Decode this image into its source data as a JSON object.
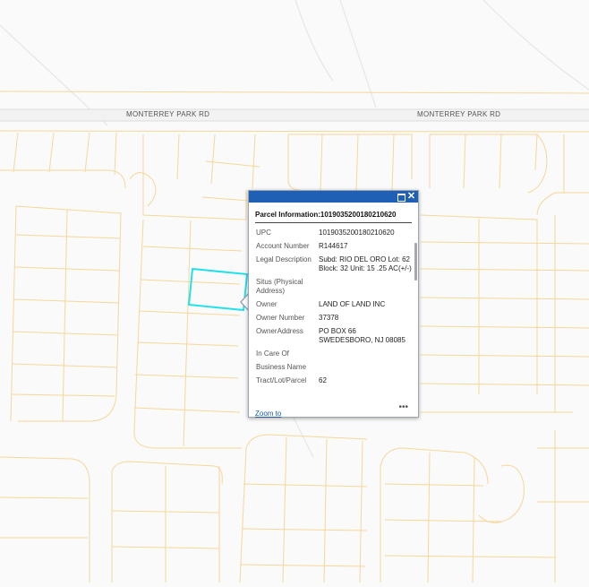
{
  "map": {
    "road_labels": [
      "MONTERREY PARK RD",
      "MONTERREY PARK RD"
    ],
    "colors": {
      "parcel_lines": "#f5d79a",
      "road": "#e0e0e0",
      "selection": "#22e0e8",
      "background": "#fafafa"
    }
  },
  "popup": {
    "header_color": "#1f5fb4",
    "maximize_icon": "maximize-icon",
    "close_icon": "close-icon",
    "close_glyph": "✕",
    "title": "Parcel Information:1019035200180210620",
    "fields": [
      {
        "key": "UPC",
        "value": "1019035200180210620"
      },
      {
        "key": "Account Number",
        "value": "R144617"
      },
      {
        "key": "Legal Description",
        "value": "Subd: RIO DEL ORO Lot: 62 Block: 32 Unit: 15 .25 AC(+/-)"
      },
      {
        "key": "Situs (Physical Address)",
        "value": ""
      },
      {
        "key": "Owner",
        "value": "LAND OF LAND INC"
      },
      {
        "key": "Owner Number",
        "value": "37378"
      },
      {
        "key": "OwnerAddress",
        "value": "PO BOX 66 SWEDESBORO, NJ 08085"
      },
      {
        "key": "In Care Of",
        "value": ""
      },
      {
        "key": "Business Name",
        "value": ""
      },
      {
        "key": "Tract/Lot/Parcel",
        "value": "62"
      }
    ],
    "zoom_label": "Zoom to",
    "more_label": "•••"
  }
}
